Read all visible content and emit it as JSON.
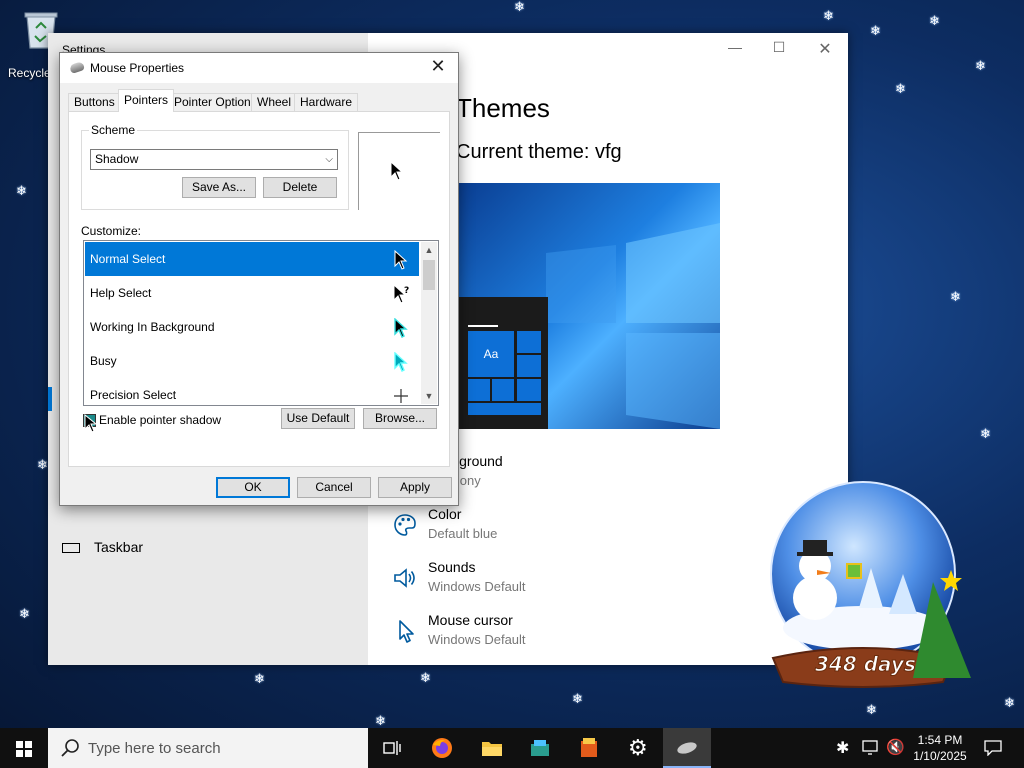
{
  "desktop": {
    "recycle_bin_label": "Recycle Bin",
    "countdown_text": "348 days"
  },
  "settings_window": {
    "title": "Settings",
    "heading": "Themes",
    "current_theme": "Current theme: vfg",
    "preview_tile_label": "Aa",
    "items": [
      {
        "name": "Background",
        "value": "Harmony",
        "icon": "image-icon"
      },
      {
        "name": "Color",
        "value": "Default blue",
        "icon": "palette-icon"
      },
      {
        "name": "Sounds",
        "value": "Windows Default",
        "icon": "speaker-icon"
      },
      {
        "name": "Mouse cursor",
        "value": "Windows Default",
        "icon": "mouse-cursor-icon"
      }
    ],
    "left_nav": {
      "taskbar_label": "Taskbar"
    }
  },
  "mouse_properties": {
    "title": "Mouse Properties",
    "tabs": [
      "Buttons",
      "Pointers",
      "Pointer Options",
      "Wheel",
      "Hardware"
    ],
    "active_tab": "Pointers",
    "scheme_label": "Scheme",
    "scheme_value": "Shadow",
    "save_as_label": "Save As...",
    "delete_label": "Delete",
    "customize_label": "Customize:",
    "cursors": [
      {
        "name": "Normal Select",
        "selected": true
      },
      {
        "name": "Help Select",
        "selected": false
      },
      {
        "name": "Working In Background",
        "selected": false
      },
      {
        "name": "Busy",
        "selected": false
      },
      {
        "name": "Precision Select",
        "selected": false
      }
    ],
    "enable_shadow_label": "Enable pointer shadow",
    "enable_shadow_checked": true,
    "use_default_label": "Use Default",
    "browse_label": "Browse...",
    "ok_label": "OK",
    "cancel_label": "Cancel",
    "apply_label": "Apply"
  },
  "taskbar": {
    "search_placeholder": "Type here to search",
    "time": "1:54 PM",
    "date": "1/10/2025"
  },
  "colors": {
    "accent": "#0078d7",
    "taskbar": "#101010"
  }
}
